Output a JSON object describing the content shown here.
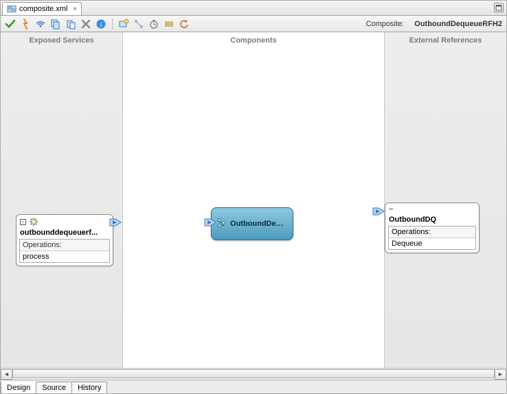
{
  "tab": {
    "filename": "composite.xml"
  },
  "header": {
    "label": "Composite:",
    "name": "OutboundDequeueRFH2"
  },
  "lanes": {
    "services": "Exposed Services",
    "components": "Components",
    "references": "External References"
  },
  "service": {
    "name": "outbounddequeuerf...",
    "ops_header": "Operations:",
    "ops": [
      "process"
    ]
  },
  "component": {
    "name": "OutboundDequeu..."
  },
  "reference": {
    "name": "OutboundDQ",
    "ops_header": "Operations:",
    "ops": [
      "Dequeue"
    ]
  },
  "bottom_tabs": {
    "design": "Design",
    "source": "Source",
    "history": "History"
  }
}
